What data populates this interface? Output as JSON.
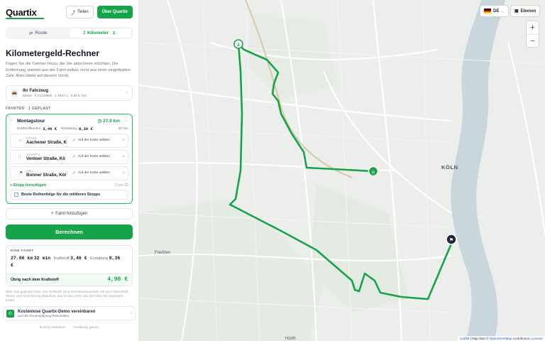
{
  "header": {
    "logo": "Quartix",
    "share_label": "Teilen",
    "about_label": "Über Quartix"
  },
  "tabs": {
    "route_label": "Route",
    "km_label": "Kilometer",
    "km_badge": "1"
  },
  "calculator": {
    "title": "Kilometergeld-Rechner",
    "intro": "Fügen Sie die Fahrten hinzu, die Sie abrechnen möchten. Die Entfernung stammt aus der Fahrt selbst, nicht aus einer eingetippten Zahl. Alles bleibt auf diesem Gerät."
  },
  "vehicle": {
    "title": "Ihr Fahrzeug",
    "subtitle": "Diesel · 7,3 L/100km · 1,75 € / L · 0,30 € / km"
  },
  "trips_label": "FAHRTEN · 1 GEPLANT",
  "trip": {
    "name": "Montagstour",
    "distance": "27.9 km",
    "fuel_label": "Kraftstoffkosten",
    "fuel_value": "3,46 €",
    "reimb_label": "Erstattung",
    "reimb_value": "8,36 €",
    "duration": "32 min",
    "stops": [
      {
        "label": "START",
        "value": "Aachener Straße, K",
        "action": "Auf der Karte wählen"
      },
      {
        "label": "STOPP 1",
        "value": "Venloer Straße, Kö",
        "action": "Auf der Karte wählen"
      },
      {
        "label": "ZIEL",
        "value": "Bonner Straße, Köl",
        "action": "Auf der Karte wählen"
      }
    ],
    "add_stop_label": "Stopp hinzufügen",
    "stop_count": "2 von 25",
    "best_order_label": "Beste Reihenfolge für die mittleren Stopps"
  },
  "add_trip_label": "Fahrt hinzufügen",
  "calculate_label": "Berechnen",
  "result": {
    "label": "EINE FAHRT",
    "distance": "27.86 km",
    "duration": "32 min",
    "fuel_label": "Kraftstoff",
    "fuel_value": "3,46 €",
    "reimb_label": "Erstattung",
    "reimb_value": "8,36",
    "reimb_currency": "€",
    "net_label": "Übrig nach dem Kraftstoff",
    "net_value": "4,90 €"
  },
  "disclaimer": "Über eine geplante Fahrt. Nur Kraftstoff. Eine Kilometerpauschale soll auch Verschleiß, Steuer und Versicherung abdecken; das ist also nicht, was die Fahrt Sie insgesamt kostet.",
  "demo": {
    "title": "Kostenlose Quartix-Demo vereinbaren",
    "subtitle": "und die Routenplanung freischalten"
  },
  "footer": {
    "built_by": "Built by Webtiers",
    "feedback": "Feedback geben"
  },
  "map": {
    "lang": "DE",
    "layers_label": "Ebenen",
    "zoom_in": "+",
    "zoom_out": "−",
    "city_label": "KÖLN",
    "frechen_label": "Frechen",
    "huerth_label": "Hürth",
    "marker_stop_number": "2",
    "attribution_leaflet": "Leaflet",
    "attribution_mid": "| Map data ©",
    "attribution_osm": "OpenStreetMap",
    "attribution_contrib": "contributors",
    "attribution_extra": "Luxmore",
    "route_color": "#16a34a"
  }
}
